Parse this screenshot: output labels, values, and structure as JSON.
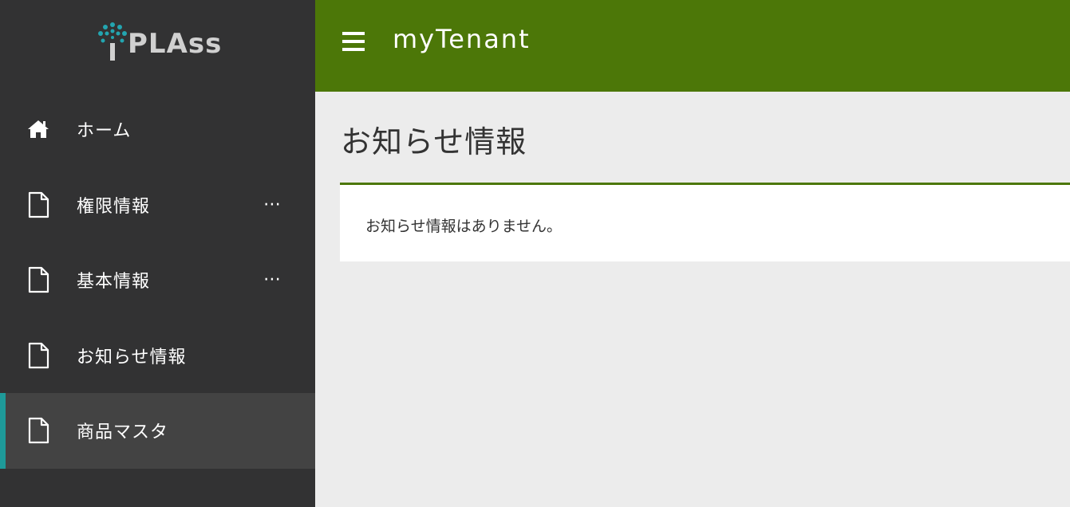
{
  "brand": {
    "logo_text": "PLAss",
    "accent": "#1e9a99"
  },
  "header": {
    "tenant_name": "myTenant",
    "menu_icon": "hamburger-icon",
    "color": "#4c7708"
  },
  "sidebar": {
    "items": [
      {
        "label": "ホーム",
        "icon": "home-icon",
        "has_more": false,
        "more": ""
      },
      {
        "label": "権限情報",
        "icon": "document-icon",
        "has_more": true,
        "more": "⋯"
      },
      {
        "label": "基本情報",
        "icon": "document-icon",
        "has_more": true,
        "more": "⋯"
      },
      {
        "label": "お知らせ情報",
        "icon": "document-icon",
        "has_more": false,
        "more": ""
      },
      {
        "label": "商品マスタ",
        "icon": "document-icon",
        "has_more": false,
        "more": "",
        "active": true
      }
    ]
  },
  "main": {
    "title": "お知らせ情報",
    "message": "お知らせ情報はありません。"
  }
}
